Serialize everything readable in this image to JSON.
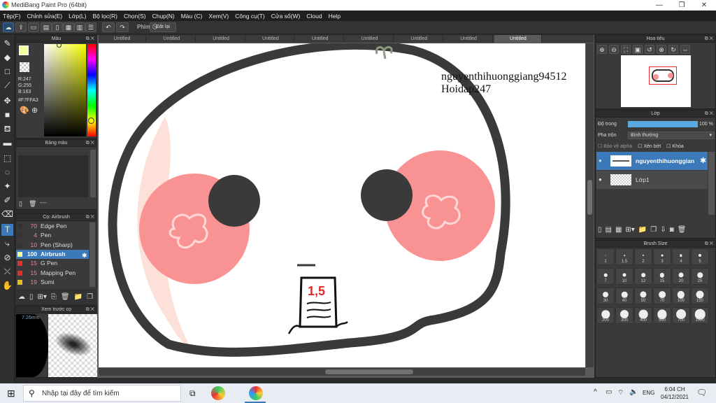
{
  "window": {
    "title": "MediBang Paint Pro (64bit)",
    "minimize": "—",
    "maximize": "❐",
    "close": "✕"
  },
  "menu": [
    "Tệp(F)",
    "Chỉnh sửa(E)",
    "Lớp(L)",
    "Bộ lọc(R)",
    "Chọn(S)",
    "Chụp(N)",
    "Màu (C)",
    "Xem(V)",
    "Công cụ(T)",
    "Cửa sổ(W)",
    "Cloud",
    "Help"
  ],
  "toolbar": {
    "phim_label": "Phím",
    "reset_label": "Đặt lại"
  },
  "tabs": [
    "Untitled",
    "Untitled",
    "Untitled",
    "Untitled",
    "Untitled",
    "Untitled",
    "Untitled",
    "Untitled",
    "Untitled"
  ],
  "color_panel": {
    "title": "Màu",
    "r": "R:247",
    "g": "G:255",
    "b": "B:163",
    "hex": "#F7FFA3",
    "fg_color": "#F7FFA3",
    "accent": "#3b79b8"
  },
  "palette_panel": {
    "title": "Bảng màu",
    "footer": "----",
    "colors": [
      "#000000",
      "#404040",
      "#808080",
      "#c0c0c0",
      "#ff0000",
      "#ff8080",
      "#ffffff",
      "#ffd0d0",
      "#ff8080",
      "#c04040",
      "#404040",
      "#808080",
      "#c0ffc0",
      "#00c000",
      "#0000ff",
      "#00ffff",
      "#ff8000",
      "#ffc080",
      "#ffffff",
      "#c0c0c0"
    ]
  },
  "brush_panel": {
    "title": "Cọ: Airbrush",
    "items": [
      {
        "num": "70",
        "name": "Edge Pen",
        "color": "#333333"
      },
      {
        "num": "4",
        "name": "Pen",
        "color": "#333333"
      },
      {
        "num": "10",
        "name": "Pen (Sharp)",
        "color": "#333333"
      },
      {
        "num": "100",
        "name": "Airbrush",
        "color": "#f7ffa3"
      },
      {
        "num": "15",
        "name": "G Pen",
        "color": "#e03030"
      },
      {
        "num": "15",
        "name": "Mapping Pen",
        "color": "#e03030"
      },
      {
        "num": "19",
        "name": "Sumi",
        "color": "#e0c020"
      }
    ]
  },
  "preview_panel": {
    "title": "Xem trước cọ",
    "size": "7.26mm"
  },
  "canvas": {
    "watermark_line1": "nguyenthihuonggiang94512",
    "watermark_line2": "Hoidap247",
    "drawn_number": "1,5"
  },
  "navigator": {
    "title": "Hoa tiêu"
  },
  "layer_panel": {
    "title": "Lớp",
    "opacity_label": "Độ trong",
    "opacity_value": "100 %",
    "blend_label": "Pha trộn",
    "blend_value": "Bình thường",
    "protect_alpha": "Bảo vệ alpha",
    "clipping": "Xén bớt",
    "lock": "Khóa",
    "layers": [
      "nguyenthihuonggian",
      "Lớp1"
    ]
  },
  "brush_size_panel": {
    "title": "Brush Size",
    "sizes": [
      "1",
      "1.5",
      "2",
      "3",
      "4",
      "5",
      "7",
      "10",
      "12",
      "15",
      "20",
      "25",
      "30",
      "40",
      "50",
      "70",
      "100",
      "150",
      "200",
      "300",
      "400",
      "500",
      "700",
      "1000"
    ]
  },
  "taskbar": {
    "search_placeholder": "Nhập tại đây để tìm kiếm",
    "language": "ENG",
    "time": "6:04 CH",
    "date": "04/12/2021"
  }
}
